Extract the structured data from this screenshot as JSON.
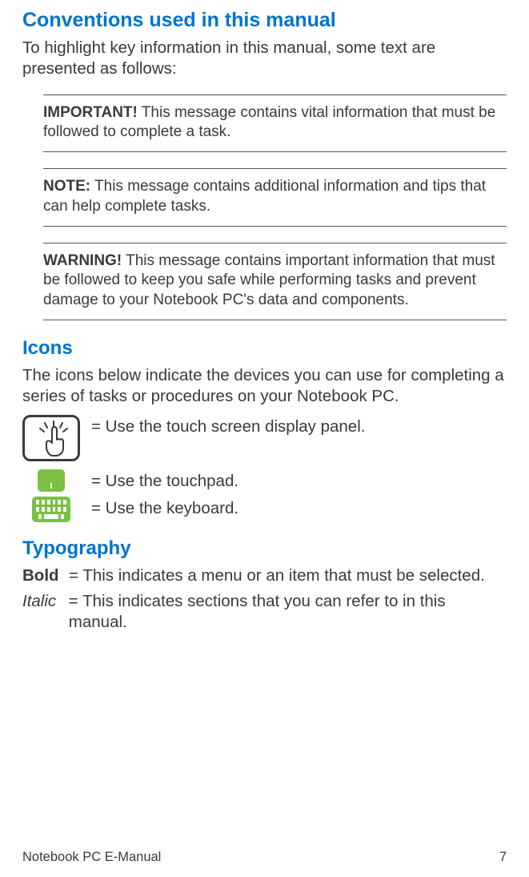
{
  "headings": {
    "conventions": "Conventions used in this manual",
    "icons": "Icons",
    "typography": "Typography"
  },
  "intro": {
    "conventions": "To highlight key information in this manual, some text are presented as follows:",
    "icons": "The icons below indicate the devices you can use for completing a series of tasks or procedures on your Notebook PC."
  },
  "callouts": {
    "important": {
      "lead": "IMPORTANT!",
      "body": " This message contains vital information that must be followed to complete a task."
    },
    "note": {
      "lead": "NOTE:",
      "body": " This message contains additional information and tips that can help complete tasks."
    },
    "warning": {
      "lead": "WARNING!",
      "body": " This message contains important information that must be followed to keep you safe while performing tasks and prevent damage to your Notebook PC's data and components."
    }
  },
  "icon_list": {
    "touchscreen": "= Use the touch screen display panel.",
    "touchpad": "= Use the touchpad.",
    "keyboard": "= Use the keyboard."
  },
  "typography": {
    "bold": {
      "label": "Bold",
      "desc": "= This indicates a menu or an item that must be selected."
    },
    "italic": {
      "label": "Italic",
      "desc": "= This indicates sections that you can refer to in this manual."
    }
  },
  "footer": {
    "title": "Notebook PC E-Manual",
    "page": "7"
  }
}
